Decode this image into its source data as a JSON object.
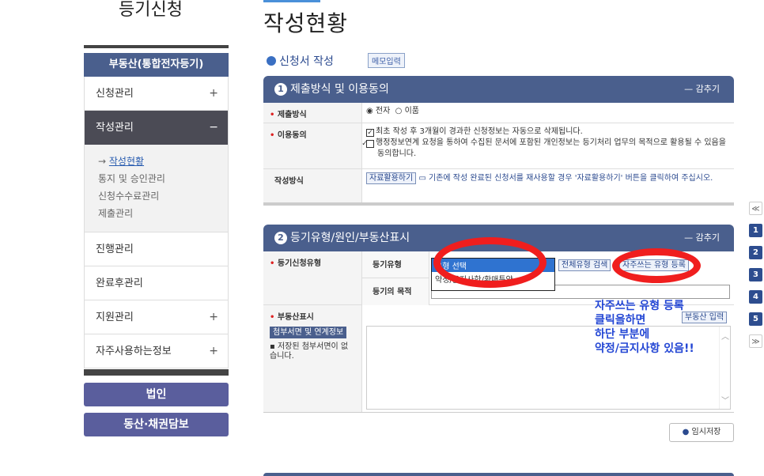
{
  "sidebar": {
    "title": "등기신청",
    "category": "부동산(통합전자등기)",
    "items": [
      {
        "label": "신청관리",
        "icon": "+"
      },
      {
        "label": "작성관리",
        "icon": "−"
      },
      {
        "label": "진행관리",
        "icon": ""
      },
      {
        "label": "완료후관리",
        "icon": ""
      },
      {
        "label": "지원관리",
        "icon": "+"
      },
      {
        "label": "자주사용하는정보",
        "icon": "+"
      }
    ],
    "subitems": [
      "작성현황",
      "통지 및 승인관리",
      "신청수수료관리",
      "제출관리"
    ],
    "buttons": [
      "법인",
      "동산·채권담보"
    ]
  },
  "main": {
    "title": "작성현황",
    "section": "신청서 작성",
    "memo_button": "메모입력",
    "panel1": {
      "num": "1",
      "title": "제출방식 및 이용동의",
      "hide": "감추기",
      "submit_label": "제출방식",
      "submit_opts": [
        {
          "label": "전자",
          "checked": true
        },
        {
          "label": "이품",
          "checked": false
        }
      ],
      "consent_label": "이용동의",
      "consent1": "최초 작성 후 3개월이 경과한 신청정보는 자동으로 삭제됩니다.",
      "consent2": "행정정보연계 요청을 통하여 수집된 문서에 포함된 개인정보는 등기처리 업무의 목적으로 활용될 수 있음을 동의합니다.",
      "method_label": "작성방식",
      "method_button": "자료활용하기",
      "method_text": "기존에 작성 완료된 신청서를 재사용할 경우 '자료활용하기' 버튼을 클릭하여 주십시오."
    },
    "panel2": {
      "num": "2",
      "title": "등기유형/원인/부동산표시",
      "hide": "감추기",
      "type_label": "등기신청유형",
      "type_sub": "등기유형",
      "purpose_sub": "등기의 목적",
      "select_options": [
        "유형 선택",
        "약정/금지사항/환매특약"
      ],
      "all_types_button": "전체유형 검색",
      "freq_button": "자주쓰는 유형 등록",
      "property_label": "부동산표시",
      "attach_button": "첨부서면 및 연계정보",
      "saved_note": "▪ 저장된 첨부서면이 없습니다.",
      "property_button": "부동산 입력"
    },
    "note_lines": [
      "자주쓰는 유형 등록",
      "클릭을하면",
      "하단 부분에",
      "약정/금지사항 있음!!"
    ],
    "save_button": "임시저장"
  },
  "pager": {
    "top": "≪",
    "pages": [
      "1",
      "2",
      "3",
      "4",
      "5"
    ],
    "bottom": "≫"
  }
}
